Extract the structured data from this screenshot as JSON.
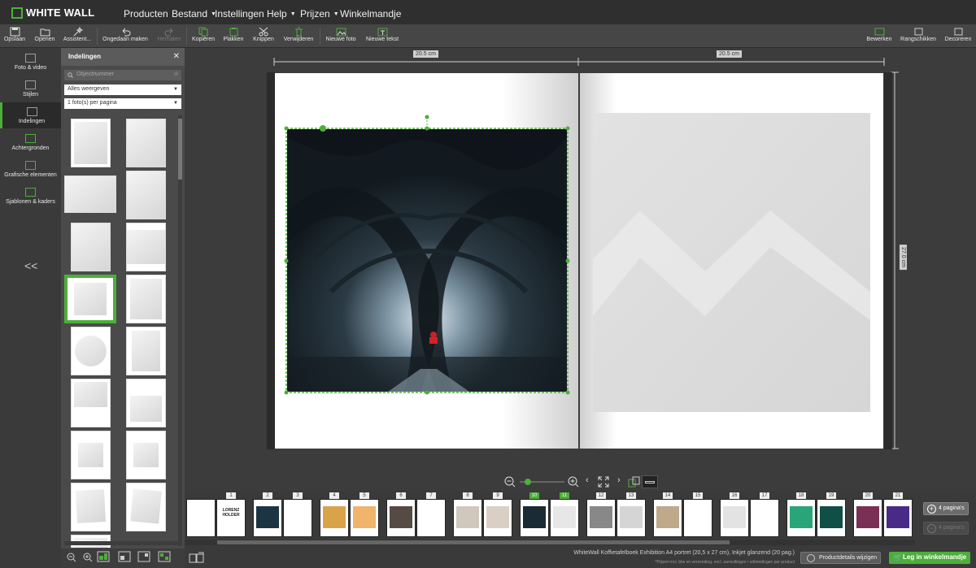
{
  "app": {
    "logo": "WHITE WALL"
  },
  "menu": [
    {
      "label": "Producten"
    },
    {
      "label": "Bestand",
      "caret": "▼"
    },
    {
      "label": "Instellingen"
    },
    {
      "label": "Help",
      "caret": "▼"
    },
    {
      "label": "Prijzen",
      "caret": "▼"
    },
    {
      "label": "Winkelmandje"
    }
  ],
  "toolbar": {
    "save": "Opslaan",
    "open": "Openen",
    "assistant": "Assistent...",
    "undo": "Ongedaan maken",
    "redo": "Herhalen",
    "copy": "Kopiëren",
    "paste": "Plakken",
    "cut": "Knippen",
    "delete": "Verwijderen",
    "new_photo": "Nieuwe foto",
    "new_text": "Nieuwe tekst",
    "edit": "Bewerken",
    "arrange": "Rangschikken",
    "decorate": "Decoreren"
  },
  "leftnav": [
    {
      "label": "Foto & video",
      "icon": "photo-icon"
    },
    {
      "label": "Stijlen",
      "icon": "book-icon"
    },
    {
      "label": "Indelingen",
      "icon": "layout-icon",
      "active": true
    },
    {
      "label": "Achtergronden",
      "icon": "background-icon"
    },
    {
      "label": "Grafische elementen",
      "icon": "shapes-icon"
    },
    {
      "label": "Sjablonen & kaders",
      "icon": "frame-icon"
    }
  ],
  "collapse": "<<",
  "panel": {
    "title": "Indelingen",
    "search_placeholder": "Objectnummer",
    "filter1": "Alles weergeven",
    "filter2": "1 foto(s) per pagina"
  },
  "canvas": {
    "width_left": "20.5 cm",
    "width_right": "20.5 cm",
    "height": "27.0 cm"
  },
  "pagestrip": {
    "page_numbers": [
      "1",
      "2",
      "3",
      "4",
      "5",
      "6",
      "7",
      "8",
      "9",
      "10",
      "11",
      "12",
      "13",
      "14",
      "15",
      "16",
      "17",
      "18",
      "19",
      "20",
      "21"
    ],
    "selected": [
      "10",
      "11"
    ],
    "cover_title": "LORENZ HOLDER",
    "add_pages": "4 pagina's",
    "remove_pages": "4 pagina's"
  },
  "status": {
    "product": "WhiteWall Koffietafelboek Exhibition A4 portret (20,5 x 27 cm), Inkjet glanzend (20 pag.)",
    "note": "*Prijzen incl. btw en verzending, excl. aanvullingen / uitbreidingen per product",
    "details_button": "Productdetails wijzigen",
    "cart_button": "Leg in winkelmandje"
  },
  "colors": {
    "accent": "#4caf3a",
    "bg": "#3c3c3c"
  }
}
